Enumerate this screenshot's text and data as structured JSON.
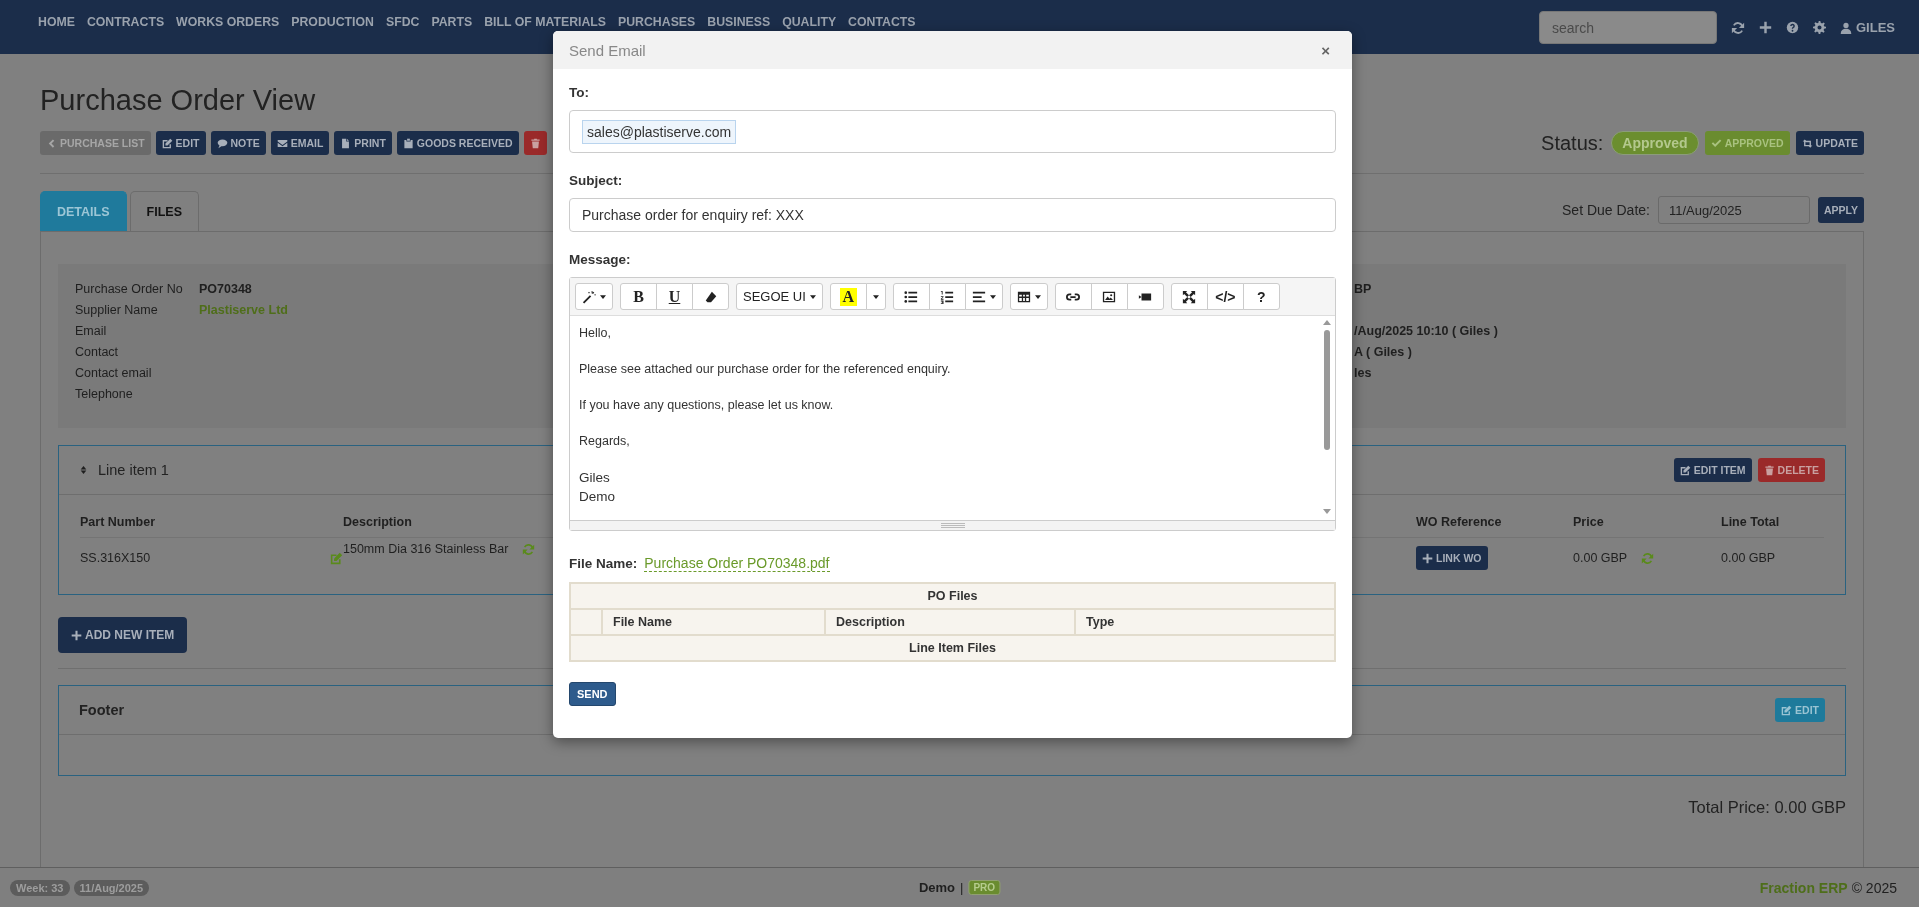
{
  "nav": {
    "items": [
      "HOME",
      "CONTRACTS",
      "WORKS ORDERS",
      "PRODUCTION",
      "SFDC",
      "PARTS",
      "BILL OF MATERIALS",
      "PURCHASES",
      "BUSINESS",
      "QUALITY",
      "CONTACTS"
    ],
    "search": {
      "placeholder": "search"
    },
    "user": "GILES"
  },
  "page": {
    "title": "Purchase Order View",
    "actions": [
      {
        "label": "PURCHASE LIST",
        "kind": "back"
      },
      {
        "label": "EDIT",
        "kind": "primary"
      },
      {
        "label": "NOTE",
        "kind": "primary"
      },
      {
        "label": "EMAIL",
        "kind": "primary"
      },
      {
        "label": "PRINT",
        "kind": "primary"
      },
      {
        "label": "GOODS RECEIVED",
        "kind": "primary"
      },
      {
        "kind": "danger"
      }
    ],
    "status": {
      "label": "Status:",
      "badge": "Approved",
      "buttons": [
        {
          "label": "APPROVED",
          "kind": "success"
        },
        {
          "label": "UPDATE",
          "kind": "primary"
        }
      ]
    },
    "tabs": [
      {
        "label": "DETAILS",
        "selected": true
      },
      {
        "label": "FILES",
        "selected": false
      }
    ],
    "due_date": {
      "label": "Set Due Date:",
      "value": "11/Aug/2025",
      "button": "APPLY"
    },
    "details": {
      "left": [
        {
          "label": "Purchase Order No",
          "value": "PO70348",
          "kind": "plain"
        },
        {
          "label": "Supplier Name",
          "value": "Plastiserve Ltd",
          "kind": "link"
        },
        {
          "label": "Email"
        },
        {
          "label": "Contact"
        },
        {
          "label": "Contact email"
        },
        {
          "label": "Telephone"
        }
      ],
      "right": [
        {
          "value": "BP"
        },
        {
          "value": "/Aug/2025 10:10 ( Giles )"
        },
        {
          "value": "A ( Giles )"
        },
        {
          "value": "les"
        }
      ]
    },
    "line_item": {
      "title": "Line item 1",
      "buttons": [
        {
          "label": "EDIT ITEM",
          "kind": "primary"
        },
        {
          "label": "DELETE",
          "kind": "danger"
        }
      ],
      "columns": [
        "Part Number",
        "Description",
        "WO Reference",
        "Price",
        "Line Total"
      ],
      "row": {
        "part_number": "SS.316X150",
        "description": "150mm Dia 316 Stainless Bar",
        "wo_button": "LINK WO",
        "price": "0.00 GBP",
        "line_total": "0.00 GBP"
      }
    },
    "add_item": "ADD NEW ITEM",
    "footer_panel": {
      "title": "Footer",
      "button": "EDIT"
    },
    "total": "Total Price: 0.00 GBP"
  },
  "modal": {
    "title": "Send Email",
    "close": "×",
    "to_label": "To:",
    "recipients": [
      "sales@plastiserve.com"
    ],
    "subject_label": "Subject:",
    "subject": "Purchase order for enquiry ref: XXX",
    "message_label": "Message:",
    "toolbar": [
      [
        {
          "kind": "icon",
          "dropdown": true
        }
      ],
      [
        {
          "kind": "bold",
          "label": "B",
          "dropdown": false
        },
        {
          "kind": "underline",
          "label": "U",
          "dropdown": false
        },
        {
          "kind": "icon",
          "dropdown": false
        }
      ],
      [
        {
          "kind": "font",
          "label": "SEGOE UI",
          "dropdown": true
        }
      ],
      [
        {
          "kind": "color",
          "label": "A",
          "dropdown": false
        },
        {
          "kind": "caret",
          "dropdown": true
        }
      ],
      [
        {
          "kind": "icon",
          "dropdown": false
        },
        {
          "kind": "icon",
          "dropdown": false
        },
        {
          "kind": "icon",
          "dropdown": true
        }
      ],
      [
        {
          "kind": "icon",
          "dropdown": true
        }
      ],
      [
        {
          "kind": "icon",
          "dropdown": false
        },
        {
          "kind": "icon",
          "dropdown": false
        },
        {
          "kind": "icon",
          "dropdown": false
        }
      ],
      [
        {
          "kind": "icon",
          "dropdown": false
        },
        {
          "kind": "text",
          "label": "</>",
          "dropdown": false
        },
        {
          "kind": "text",
          "label": "?",
          "dropdown": false
        }
      ]
    ],
    "message": [
      [
        "Hello,"
      ],
      [
        "Please see attached our purchase order for the referenced enquiry."
      ],
      [
        "If you have any questions, please let us know."
      ],
      [
        "Regards,"
      ],
      [
        "Giles",
        "Demo"
      ]
    ],
    "file_name_label": "File Name:",
    "file_name": "Purchase Order PO70348.pdf",
    "files_table": {
      "title": "PO Files",
      "columns": [
        "File Name",
        "Description",
        "Type"
      ],
      "section": "Line Item Files"
    },
    "send": "SEND"
  },
  "status_bar": {
    "week": "Week: 33",
    "date": "11/Aug/2025",
    "company": "Demo",
    "separator": "|",
    "edition": "PRO",
    "brand": "Fraction ERP",
    "copyright": "© 2025"
  }
}
